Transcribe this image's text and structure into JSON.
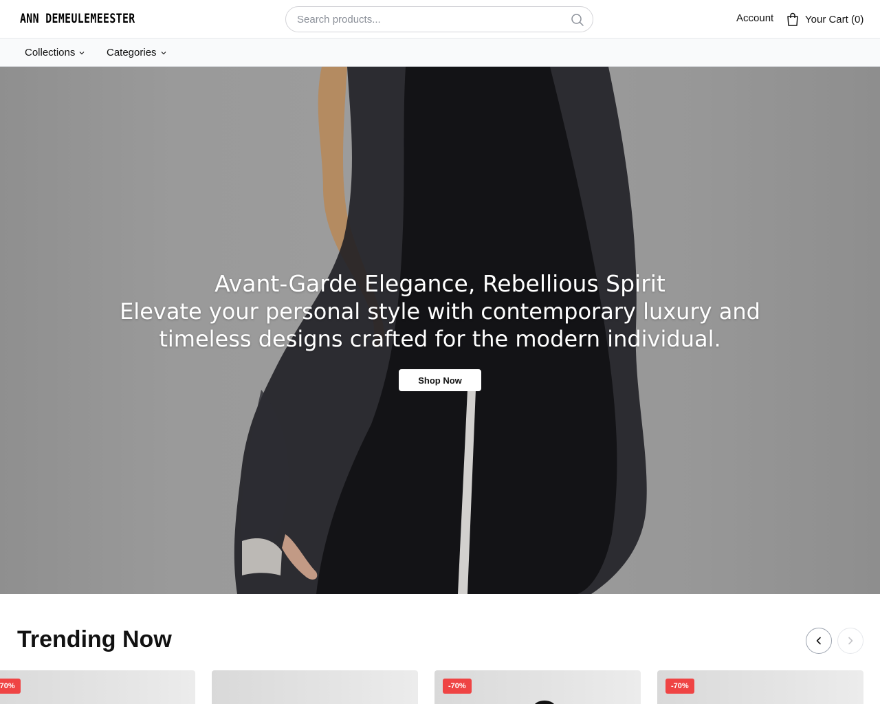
{
  "brand": {
    "logo": "ANN DEMEULEMEESTER"
  },
  "search": {
    "placeholder": "Search products..."
  },
  "header": {
    "account_label": "Account",
    "cart_label": "Your Cart (0)"
  },
  "nav": {
    "items": [
      {
        "label": "Collections"
      },
      {
        "label": "Categories"
      }
    ]
  },
  "hero": {
    "title": "Avant-Garde Elegance, Rebellious Spirit",
    "subtitle": "Elevate your personal style with contemporary luxury and timeless designs crafted for the modern individual.",
    "cta_label": "Shop Now"
  },
  "trending": {
    "title": "Trending Now",
    "cards": [
      {
        "badge": "-70%"
      },
      {
        "badge": ""
      },
      {
        "badge": "-70%"
      },
      {
        "badge": "-70%"
      }
    ]
  },
  "colors": {
    "badge": "#ef4444",
    "accent": "#111111",
    "hero_bg": "#9a9a9a"
  },
  "icons": [
    "search-icon",
    "bag-icon",
    "chevron-down-icon",
    "chevron-left-icon",
    "chevron-right-icon"
  ]
}
